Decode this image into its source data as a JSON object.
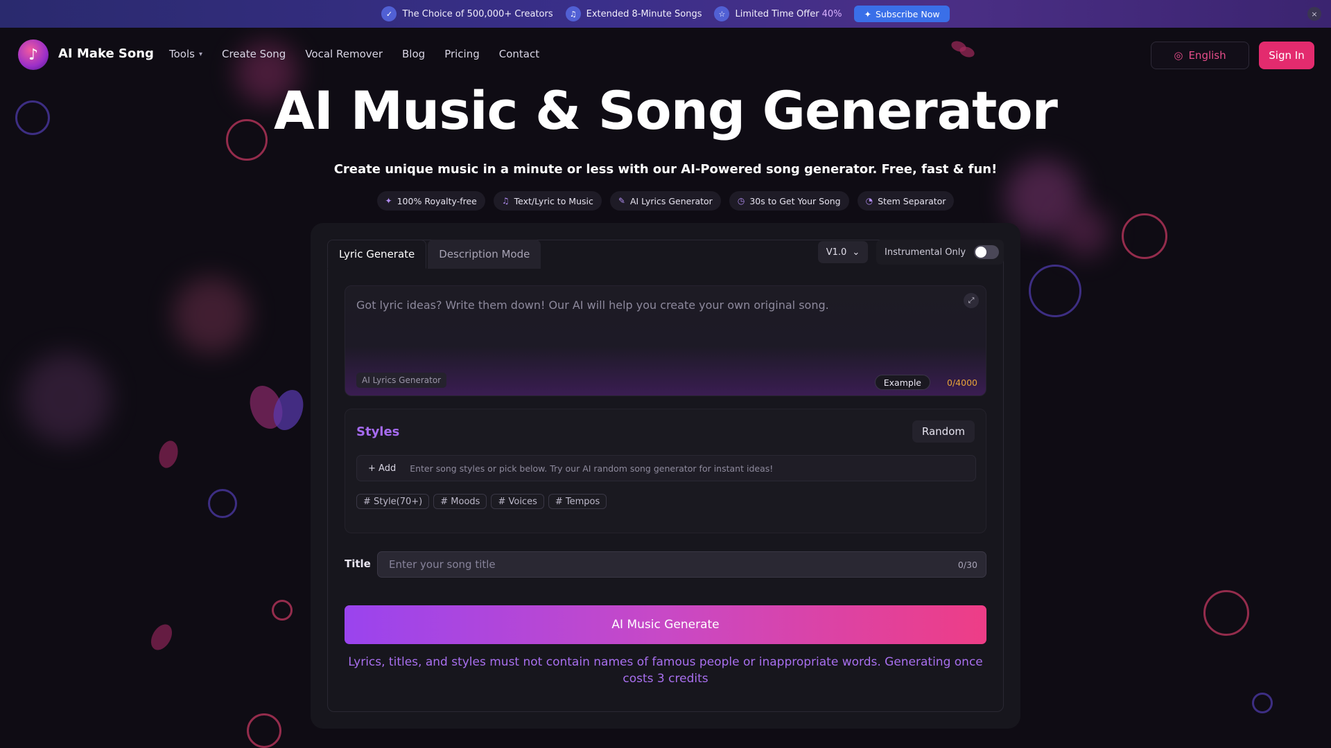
{
  "banner": {
    "item1": "The Choice of 500,000+ Creators",
    "item2": "Extended 8-Minute Songs",
    "item3": "Limited Time Offer",
    "item3_pct": "40%",
    "subscribe": "Subscribe Now",
    "close": "×"
  },
  "nav": {
    "brand": "AI Make Song",
    "tools": "Tools",
    "create_song": "Create Song",
    "vocal_remover": "Vocal Remover",
    "blog": "Blog",
    "pricing": "Pricing",
    "contact": "Contact",
    "language": "English",
    "sign_in": "Sign In"
  },
  "hero": {
    "title": "AI Music & Song Generator",
    "subtitle": "Create unique music in a minute or less with our AI-Powered song generator. Free, fast & fun!",
    "features": [
      "100% Royalty-free",
      "Text/Lyric to Music",
      "AI Lyrics Generator",
      "30s to Get Your Song",
      "Stem Separator"
    ]
  },
  "generator": {
    "tab_lyric": "Lyric Generate",
    "tab_description": "Description Mode",
    "version": "V1.0",
    "instrumental_label": "Instrumental Only",
    "instrumental_on": false,
    "lyric_placeholder": "Got lyric ideas? Write them down! Our AI will help you create your own original song.",
    "lyrics_generator_chip": "AI Lyrics Generator",
    "example_chip": "Example",
    "lyric_count": "0/4000",
    "styles_title": "Styles",
    "random_btn": "Random",
    "add_btn": "+ Add",
    "style_placeholder": "Enter song styles or pick below. Try our AI random song generator for instant ideas!",
    "style_tags": [
      "# Style(70+)",
      "# Moods",
      "# Voices",
      "# Tempos"
    ],
    "title_label": "Title",
    "title_placeholder": "Enter your song title",
    "title_count": "0/30",
    "generate_btn": "AI Music Generate",
    "notice": "Lyrics, titles, and styles must not contain names of famous people or inappropriate words. Generating once costs 3 credits"
  },
  "colors": {
    "accent_pink": "#e32b6e",
    "accent_purple": "#a66bf0",
    "count_orange": "#e7a23a"
  }
}
